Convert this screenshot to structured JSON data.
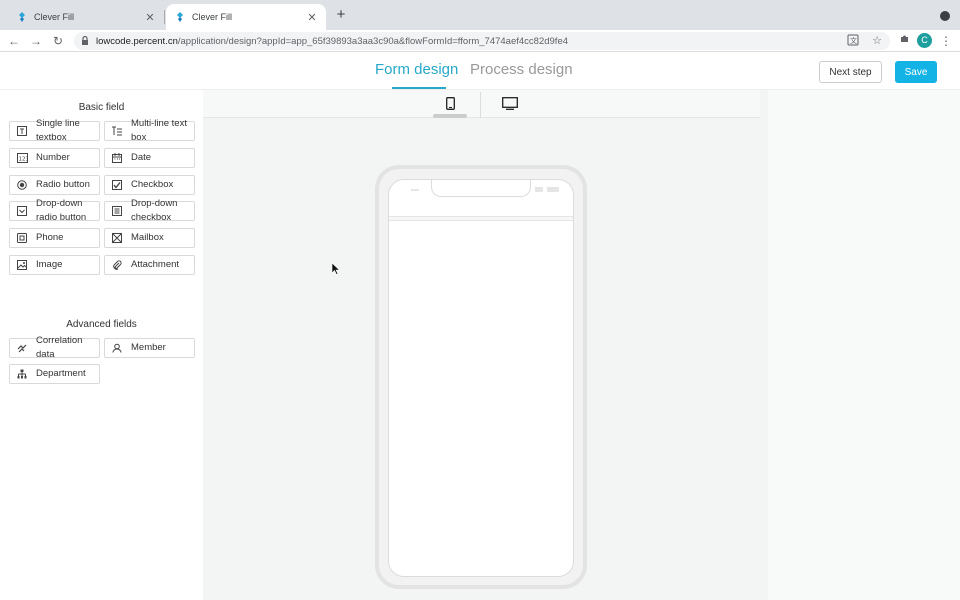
{
  "browser": {
    "tabs": [
      {
        "title": "Clever Fill",
        "active": false
      },
      {
        "title": "Clever Fill",
        "active": true
      }
    ],
    "url_host": "lowcode.percent.cn",
    "url_path": "/application/design?appId=app_65f39893a3aa3c90a&flowFormId=fform_7474aef4cc82d9fe4",
    "profile_initial": "C",
    "icons": [
      "back-icon",
      "forward-icon",
      "reload-icon",
      "lock-icon",
      "translate-icon",
      "star-icon",
      "extensions-icon",
      "menu-icon"
    ]
  },
  "header": {
    "tabs": [
      {
        "label": "Form design",
        "active": true
      },
      {
        "label": "Process design",
        "active": false
      }
    ],
    "next_label": "Next step",
    "save_label": "Save",
    "accent_color": "#27a8c9",
    "save_color": "#14b3e6"
  },
  "left_panel": {
    "basic_title": "Basic field",
    "basic_fields": [
      {
        "label": "Single line textbox",
        "icon": "single-line-icon"
      },
      {
        "label": "Multi-line text box",
        "icon": "multi-line-icon"
      },
      {
        "label": "Number",
        "icon": "number-icon"
      },
      {
        "label": "Date",
        "icon": "calendar-icon"
      },
      {
        "label": "Radio button",
        "icon": "radio-icon"
      },
      {
        "label": "Checkbox",
        "icon": "checkbox-icon"
      },
      {
        "label": "Drop-down radio button",
        "icon": "dropdown-icon"
      },
      {
        "label": "Drop-down checkbox",
        "icon": "dropdown-list-icon"
      },
      {
        "label": "Phone",
        "icon": "phone-icon"
      },
      {
        "label": "Mailbox",
        "icon": "mail-icon"
      },
      {
        "label": "Image",
        "icon": "image-icon"
      },
      {
        "label": "Attachment",
        "icon": "paperclip-icon"
      }
    ],
    "advanced_title": "Advanced fields",
    "advanced_fields": [
      {
        "label": "Correlation data",
        "icon": "link-icon"
      },
      {
        "label": "Member",
        "icon": "member-icon"
      },
      {
        "label": "Department",
        "icon": "org-chart-icon"
      }
    ]
  },
  "canvas": {
    "devices": [
      {
        "name": "mobile",
        "icon": "mobile-icon",
        "active": true
      },
      {
        "name": "pc",
        "icon": "monitor-icon",
        "active": false
      }
    ]
  }
}
